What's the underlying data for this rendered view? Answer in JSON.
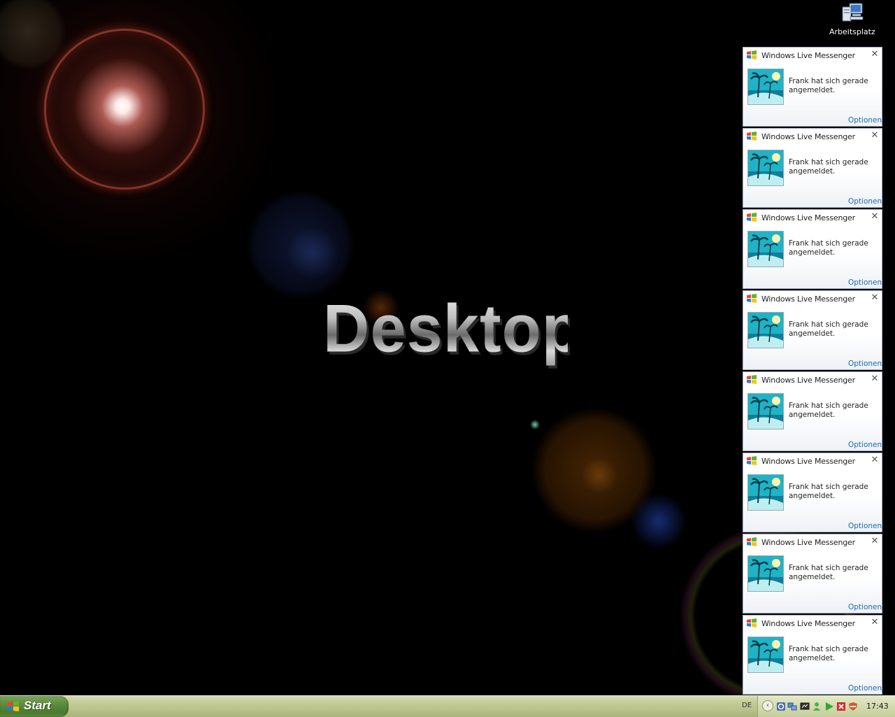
{
  "desktop": {
    "wallpaper_text": "Desktop",
    "icons": [
      {
        "label": "Arbeitsplatz",
        "icon": "my-computer-icon"
      }
    ]
  },
  "notifications": [
    {
      "app": "Windows Live Messenger",
      "message": "Frank hat sich gerade angemeldet.",
      "link": "Optionen",
      "close": "✕"
    },
    {
      "app": "Windows Live Messenger",
      "message": "Frank hat sich gerade angemeldet.",
      "link": "Optionen",
      "close": "✕"
    },
    {
      "app": "Windows Live Messenger",
      "message": "Frank hat sich gerade angemeldet.",
      "link": "Optionen",
      "close": "✕"
    },
    {
      "app": "Windows Live Messenger",
      "message": "Frank hat sich gerade angemeldet.",
      "link": "Optionen",
      "close": "✕"
    },
    {
      "app": "Windows Live Messenger",
      "message": "Frank hat sich gerade angemeldet.",
      "link": "Optionen",
      "close": "✕"
    },
    {
      "app": "Windows Live Messenger",
      "message": "Frank hat sich gerade angemeldet.",
      "link": "Optionen",
      "close": "✕"
    },
    {
      "app": "Windows Live Messenger",
      "message": "Frank hat sich gerade angemeldet.",
      "link": "Optionen",
      "close": "✕"
    },
    {
      "app": "Windows Live Messenger",
      "message": "Frank hat sich gerade angemeldet.",
      "link": "Optionen",
      "close": "✕"
    }
  ],
  "taskbar": {
    "start_label": "Start",
    "language": "DE",
    "clock": "17:43",
    "tray_icons": [
      "show-hidden-icons-chevron",
      "headset-icon",
      "network-icon",
      "display-icon",
      "messenger-buddy-icon",
      "media-play-icon",
      "security-alert-icon",
      "shield-icon"
    ]
  },
  "colors": {
    "taskbar": "#c4cd98",
    "start_button": "#5d8a3e",
    "toast_border": "#a7b1bd",
    "link": "#1d6bb6"
  }
}
